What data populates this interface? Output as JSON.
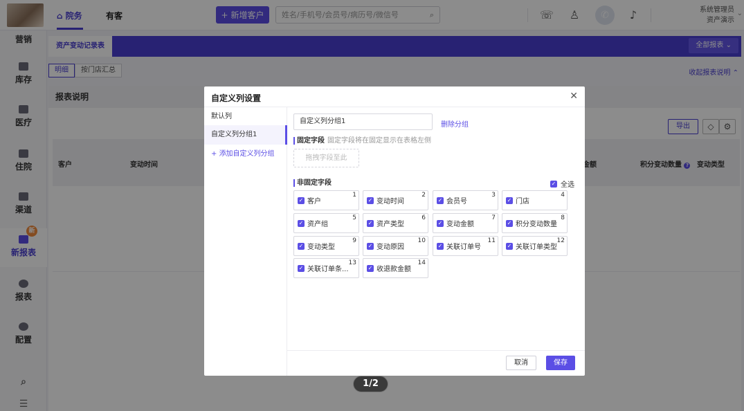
{
  "topbar": {
    "nav": [
      {
        "label": "院务",
        "active": true
      },
      {
        "label": "有客",
        "active": false
      }
    ],
    "new_customer_label": "新增客户",
    "search_placeholder": "姓名/手机号/会员号/病历号/微信号",
    "user_name": "系统管理员",
    "user_sub": "资产演示",
    "icons": [
      "wechat-icon",
      "user-icon",
      "phone-icon",
      "bell-icon",
      "search-icon"
    ]
  },
  "sidebar": {
    "items": [
      {
        "label": "营销"
      },
      {
        "label": "库存"
      },
      {
        "label": "医疗"
      },
      {
        "label": "住院"
      },
      {
        "label": "渠道"
      },
      {
        "label": "新报表",
        "badge": "新",
        "active": true
      },
      {
        "label": "报表"
      },
      {
        "label": "配置"
      }
    ]
  },
  "main": {
    "tab_label": "资产变动记录表",
    "all_reports_label": "全部报表",
    "sub_tabs": [
      "明细",
      "按门店汇总"
    ],
    "collapse_label": "收起报表说明",
    "report_desc_label": "报表说明",
    "export_label": "导出",
    "columns": [
      "客户",
      "变动时间",
      "金额",
      "积分变动数量",
      "变动类型"
    ]
  },
  "modal": {
    "title": "自定义列设置",
    "left_items": [
      "默认列",
      "自定义列分组1"
    ],
    "add_group_label": "添加自定义列分组",
    "group_name": "自定义列分组1",
    "delete_group_label": "删除分组",
    "fixed_title": "固定字段",
    "fixed_hint": "固定字段将在固定显示在表格左侧",
    "drop_zone_label": "拖拽字段至此",
    "nonfixed_title": "非固定字段",
    "select_all_label": "全选",
    "fields": [
      {
        "label": "客户",
        "num": "1"
      },
      {
        "label": "变动时间",
        "num": "2"
      },
      {
        "label": "会员号",
        "num": "3"
      },
      {
        "label": "门店",
        "num": "4"
      },
      {
        "label": "资产组",
        "num": "5"
      },
      {
        "label": "资产类型",
        "num": "6"
      },
      {
        "label": "变动金额",
        "num": "7"
      },
      {
        "label": "积分变动数量",
        "num": "8"
      },
      {
        "label": "变动类型",
        "num": "9"
      },
      {
        "label": "变动原因",
        "num": "10"
      },
      {
        "label": "关联订单号",
        "num": "11"
      },
      {
        "label": "关联订单类型",
        "num": "12"
      },
      {
        "label": "关联订单条...",
        "num": "13"
      },
      {
        "label": "收退款金额",
        "num": "14"
      }
    ],
    "cancel_label": "取消",
    "save_label": "保存"
  },
  "pager": "1/2",
  "colors": {
    "accent": "#5b4ee5",
    "badge": "#f08a3c"
  }
}
